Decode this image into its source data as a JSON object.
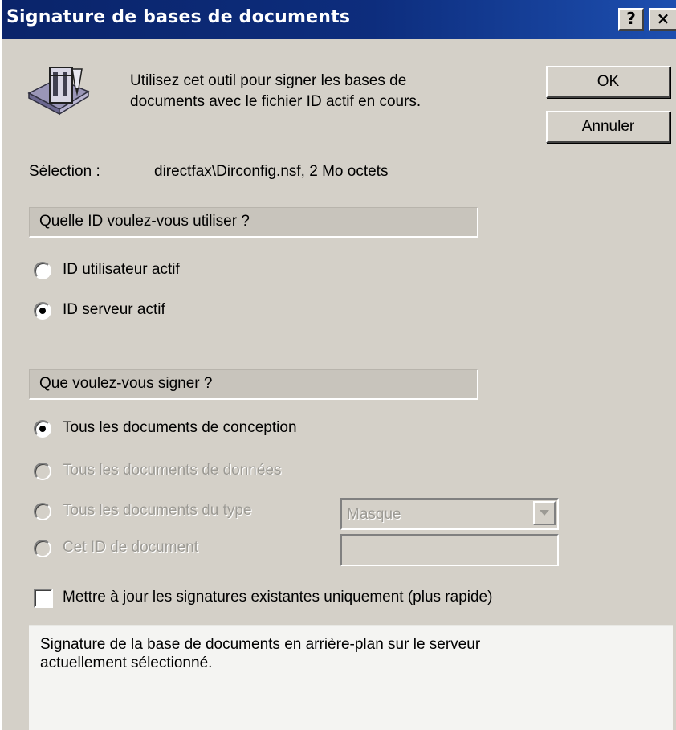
{
  "window": {
    "title": "Signature de bases de documents",
    "help_label": "?",
    "close_label": "×"
  },
  "icon": "sign-database-tool-icon",
  "description": {
    "line1": "Utilisez cet outil pour signer les bases de",
    "line2": "documents avec le fichier ID actif en cours."
  },
  "buttons": {
    "ok": "OK",
    "cancel": "Annuler"
  },
  "selection": {
    "label": "Sélection :",
    "value": "directfax\\Dirconfig.nsf, 2 Mo octets"
  },
  "id_section": {
    "title": "Quelle ID voulez-vous utiliser ?",
    "options": [
      {
        "label": "ID utilisateur actif",
        "checked": false
      },
      {
        "label": "ID serveur actif",
        "checked": true
      }
    ]
  },
  "sign_section": {
    "title": "Que voulez-vous signer ?",
    "options": [
      {
        "label": "Tous les documents de conception",
        "checked": true,
        "enabled": true
      },
      {
        "label": "Tous les documents de données",
        "checked": false,
        "enabled": false
      },
      {
        "label": "Tous les documents du type",
        "checked": false,
        "enabled": false
      },
      {
        "label": "Cet ID de document",
        "checked": false,
        "enabled": false
      }
    ],
    "type_dropdown": {
      "selected": "Masque"
    },
    "doc_id_field": {
      "value": ""
    }
  },
  "update_checkbox": {
    "label": "Mettre à jour les signatures existantes uniquement (plus rapide)",
    "checked": false
  },
  "info": {
    "line1": "Signature de la base de documents en arrière-plan sur le serveur",
    "line2": "actuellement sélectionné."
  },
  "colors": {
    "titlebar": "#0a246a",
    "dialog_bg": "#d4d0c8",
    "disabled_text": "#9c9a94"
  }
}
